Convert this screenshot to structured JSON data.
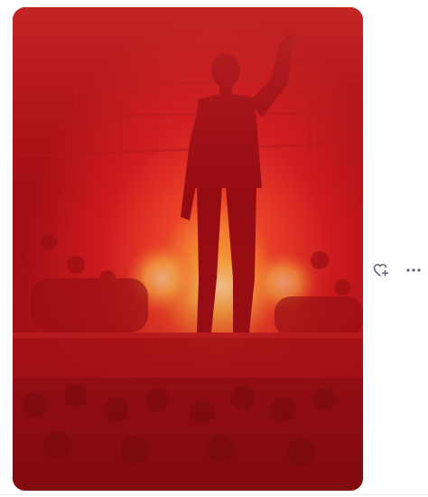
{
  "photo": {
    "alt_description": ""
  },
  "actions": {
    "react_icon": "heart-plus-icon",
    "more_icon": "more-horizontal-icon"
  },
  "colors": {
    "photo_red": "#c8141a",
    "flare_yellow": "#ffd45a",
    "icon_gray": "#5b6470"
  }
}
